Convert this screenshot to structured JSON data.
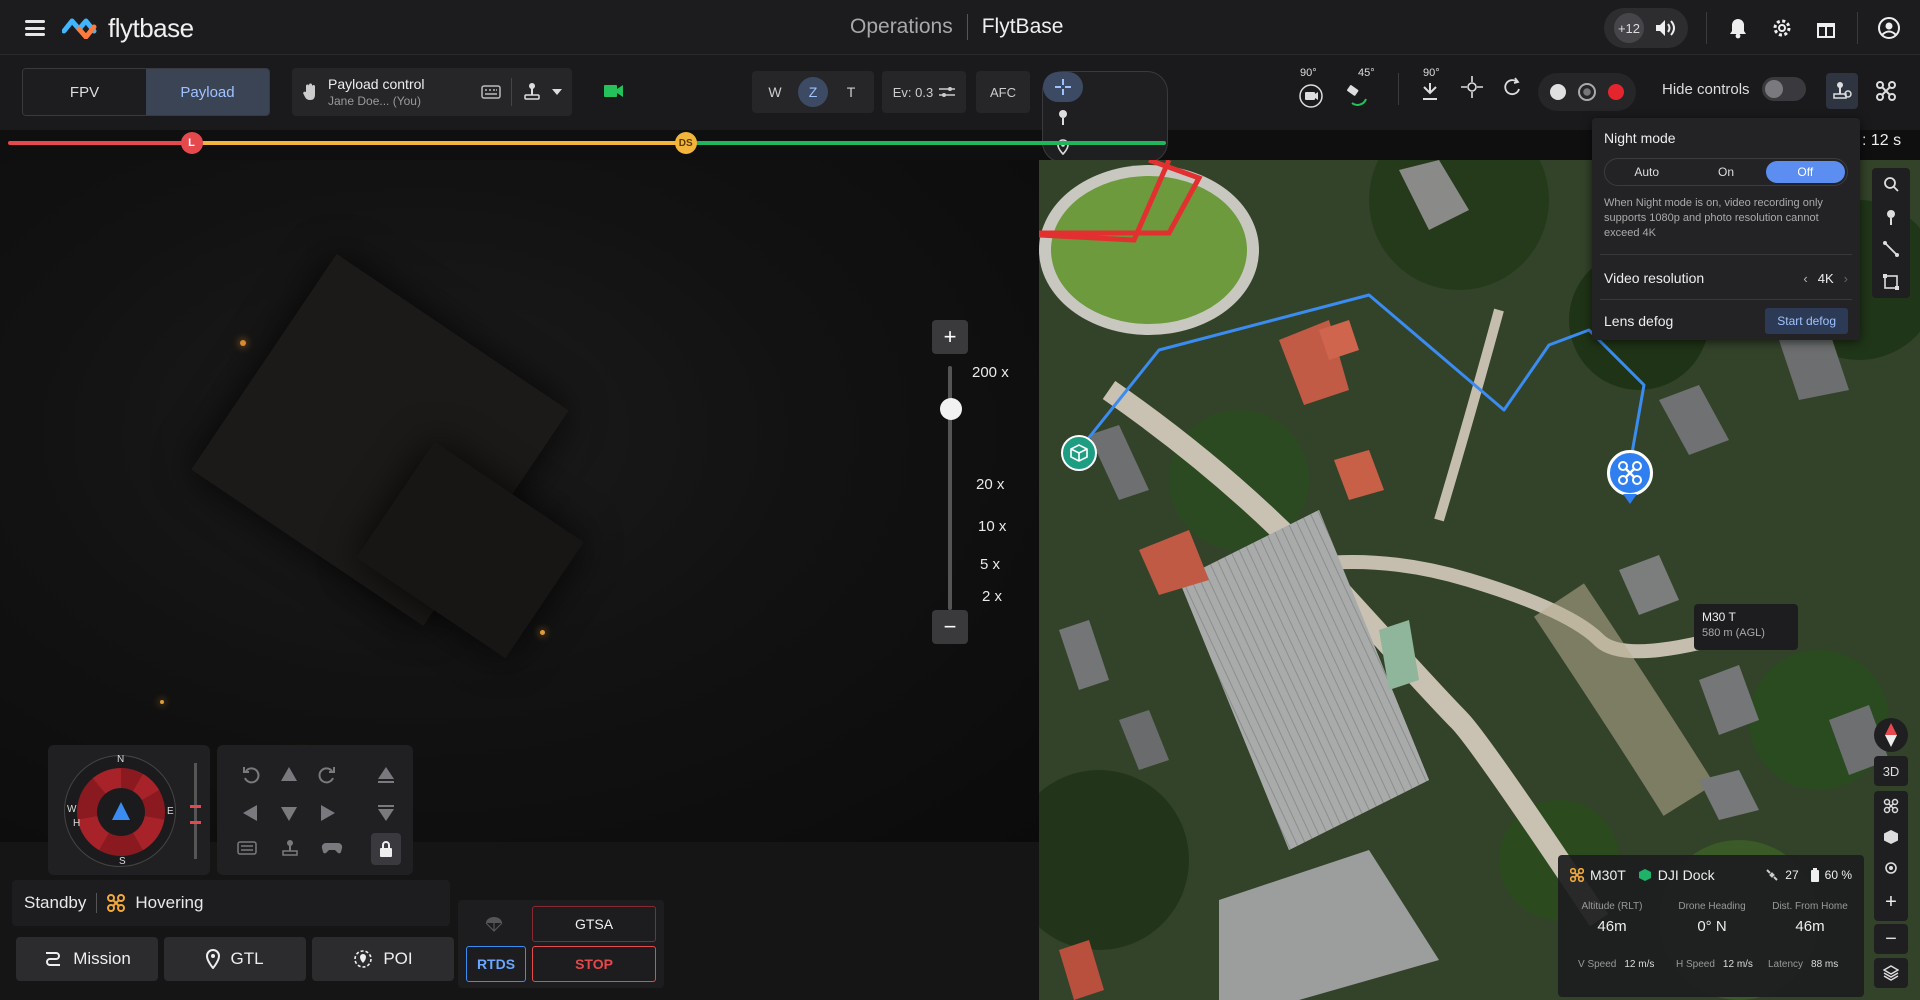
{
  "topbar": {
    "logo_text": "flytbase",
    "breadcrumb_section": "Operations",
    "breadcrumb_org": "FlytBase",
    "notification_count": "+12"
  },
  "mode_tabs": {
    "fpv": "FPV",
    "payload": "Payload"
  },
  "payload_control": {
    "title": "Payload control",
    "user": "Jane Doe... (You)"
  },
  "camera": {
    "lens_modes": [
      "W",
      "Z",
      "T"
    ],
    "active_lens": "Z",
    "ev": "Ev: 0.3",
    "afc": "AFC",
    "gimbal_pitch": "90°",
    "gimbal_yaw": "45°",
    "gimbal_reset": "90°"
  },
  "hide_controls_label": "Hide controls",
  "timeline": {
    "marker_l": "L",
    "marker_ds": "DS",
    "timer": ": 12 s",
    "progress_red_pct": 13,
    "progress_yellow_pct": 48,
    "progress_green_pct": 82
  },
  "zoom": {
    "plus": "+",
    "minus": "−",
    "levels": [
      "200 x",
      "20 x",
      "10 x",
      "5 x",
      "2 x"
    ]
  },
  "compass": {
    "n": "N",
    "s": "S",
    "e": "E",
    "w": "W",
    "h": "H"
  },
  "status": {
    "state": "Standby",
    "flight_state": "Hovering"
  },
  "actions": {
    "mission": "Mission",
    "gtl": "GTL",
    "poi": "POI"
  },
  "safety": {
    "gtsa": "GTSA",
    "rtds": "RTDS",
    "stop": "STOP"
  },
  "night_mode": {
    "title": "Night mode",
    "options": [
      "Auto",
      "On",
      "Off"
    ],
    "selected": "Off",
    "note": "When Night mode is on, video recording only supports 1080p and photo resolution cannot exceed 4K",
    "video_resolution_label": "Video resolution",
    "video_resolution_value": "4K",
    "lens_defog_label": "Lens defog",
    "defog_button": "Start defog"
  },
  "map": {
    "drone_label": "M30 T",
    "drone_alt": "580 m (AGL)",
    "btn_3d": "3D"
  },
  "telemetry": {
    "drone": "M30T",
    "dock": "DJI Dock",
    "satellites": "27",
    "battery": "60 %",
    "altitude_label": "Altitude (RLT)",
    "altitude": "46m",
    "heading_label": "Drone Heading",
    "heading": "0° N",
    "dist_label": "Dist. From Home",
    "dist": "46m",
    "vspeed_label": "V Speed",
    "vspeed": "12 m/s",
    "hspeed_label": "H Speed",
    "hspeed": "12 m/s",
    "latency_label": "Latency",
    "latency": "88 ms"
  },
  "colors": {
    "accent_blue": "#5b8ef0",
    "stop_red": "#e5484d",
    "dock_green": "#1fb36a",
    "flight_path": "#3b8cf0"
  }
}
